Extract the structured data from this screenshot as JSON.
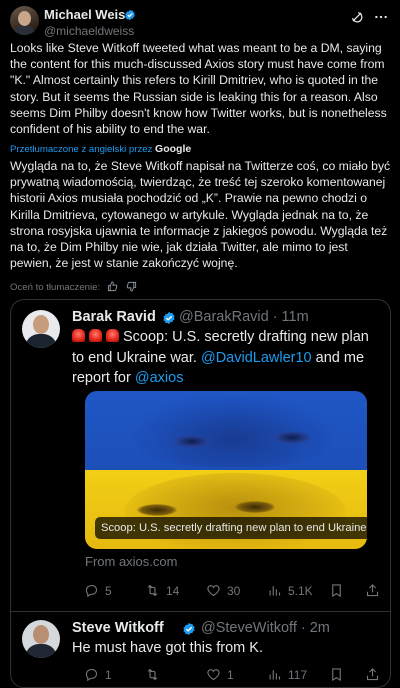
{
  "author": {
    "name": "Michael Weiss",
    "handle": "@michaeldweiss"
  },
  "post": {
    "original_text": "Looks like Steve Witkoff tweeted what was meant to be a DM, saying the content for this much-discussed Axios story must have come from \"K.\" Almost certainly this refers to Kirill Dmitriev, who is quoted in the story. But it seems the Russian side is leaking this for a reason. Also seems Dim Philby doesn't know how Twitter works, but is nonetheless confident of his ability to end the war.",
    "translation_note": "Przetłumaczone z angielski przez",
    "translation_provider": "Google",
    "translated_text": "Wygląda na to, że Steve Witkoff napisał na Twitterze coś, co miało być prywatną wiadomością, twierdząc, że treść tej szeroko komentowanej historii Axios musiała pochodzić od „K”. Prawie na pewno chodzi o Kirilla Dmitrieva, cytowanego w artykule. Wygląda jednak na to, że strona rosyjska ujawnia te informacje z jakiegoś powodu. Wygląda też na to, że Dim Philby nie wie, jak działa Twitter, ale mimo to jest pewien, że jest w stanie zakończyć wojnę.",
    "rate_label": "Oceń to tłumaczenie:"
  },
  "quoted": {
    "name": "Barak Ravid",
    "handle": "@BarakRavid · 11m",
    "text_part1": "Scoop: U.S. secretly drafting new plan to end Ukraine war.",
    "mention1": "@DavidLawler10",
    "text_part2": "and me report for",
    "mention2": "@axios",
    "media_caption": "Scoop: U.S. secretly drafting new plan to end Ukraine...",
    "link_source": "From axios.com",
    "stats": {
      "replies": "5",
      "reposts": "14",
      "likes": "30",
      "views": "5.1K"
    }
  },
  "reply": {
    "name": "Steve Witkoff",
    "handle": "@SteveWitkoff · 2m",
    "text": "He must have got this from K.",
    "stats": {
      "replies": "1",
      "reposts": "",
      "likes": "1",
      "views": "117"
    }
  },
  "icons": {
    "verified": "verified-badge-icon",
    "header": [
      "grok-icon",
      "more-icon"
    ],
    "rate": [
      "thumbs-up-icon",
      "thumbs-down-icon"
    ],
    "actions": [
      "reply-icon",
      "repost-icon",
      "like-icon",
      "views-icon",
      "bookmark-icon",
      "share-icon"
    ]
  },
  "colors": {
    "background": "#000000",
    "text": "#e7e9ea",
    "muted": "#71767b",
    "link": "#1d9bf0",
    "border": "#2f3336"
  }
}
